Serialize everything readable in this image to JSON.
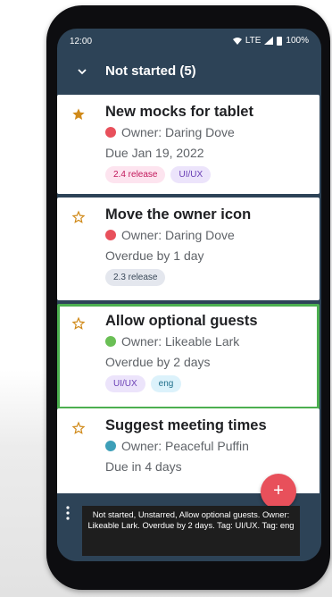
{
  "status": {
    "time": "12:00",
    "network": "LTE",
    "battery": "100%"
  },
  "section": {
    "title": "Not started (5)"
  },
  "tasks": [
    {
      "title": "New mocks for tablet",
      "owner": "Owner: Daring Dove",
      "due": "Due Jan 19, 2022",
      "starred": true,
      "avatar_color": "#e8505b",
      "tags": [
        {
          "label": "2.4 release",
          "bg": "#fde4ef",
          "color": "#c2185b"
        },
        {
          "label": "UI/UX",
          "bg": "#ece4fb",
          "color": "#6a3fb5"
        }
      ]
    },
    {
      "title": "Move the owner icon",
      "owner": "Owner: Daring Dove",
      "due": "Overdue by 1 day",
      "starred": false,
      "avatar_color": "#e8505b",
      "tags": [
        {
          "label": "2.3 release",
          "bg": "#e4e7ee",
          "color": "#3b4a5a"
        }
      ]
    },
    {
      "title": "Allow optional guests",
      "owner": "Owner: Likeable Lark",
      "due": "Overdue by 2 days",
      "starred": false,
      "avatar_color": "#6abf55",
      "tags": [
        {
          "label": "UI/UX",
          "bg": "#ece4fb",
          "color": "#6a3fb5"
        },
        {
          "label": "eng",
          "bg": "#dcf2fb",
          "color": "#1f6f8b"
        }
      ]
    },
    {
      "title": "Suggest meeting times",
      "owner": "Owner: Peaceful Puffin",
      "due": "Due in 4 days",
      "starred": false,
      "avatar_color": "#3d9fb8",
      "tags": []
    }
  ],
  "fab": {
    "label": "+"
  },
  "toast": {
    "text": "Not started, Unstarred, Allow optional guests. Owner: Likeable Lark. Overdue by 2 days. Tag: UI/UX. Tag: eng"
  },
  "colors": {
    "header_bg": "#2d4357",
    "focus_border": "#4caf50",
    "star_color": "#d08a1a",
    "fab_bg": "#e8505b"
  },
  "icons": [
    "wifi-icon",
    "signal-icon",
    "battery-icon",
    "chevron-down-icon",
    "star-icon",
    "more-vert-icon",
    "plus-icon"
  ]
}
